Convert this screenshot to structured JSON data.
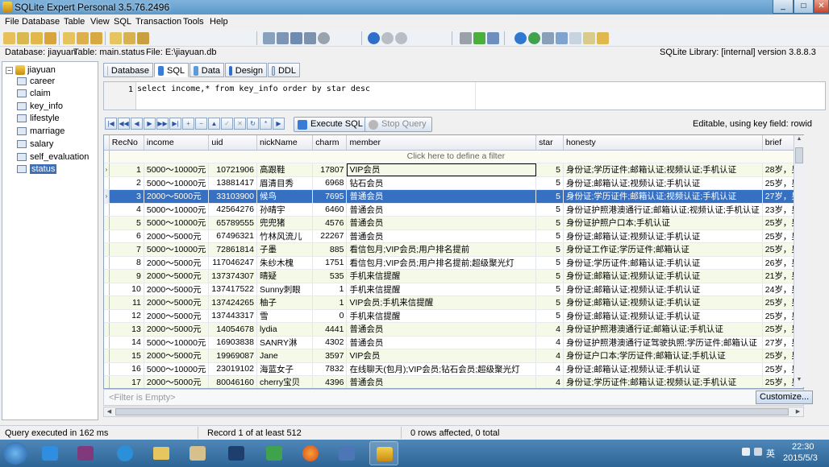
{
  "window": {
    "title": "SQLite Expert Personal 3.5.76.2496",
    "min": "_",
    "max": "□",
    "close": "✕"
  },
  "menu": [
    "File",
    "Database",
    "Table",
    "View",
    "SQL",
    "Transaction",
    "Tools",
    "Help"
  ],
  "info": {
    "database": "Database: jiayuan",
    "table": "Table: main.status",
    "file": "File: E:\\jiayuan.db",
    "library": "SQLite Library: [internal] version 3.8.8.3"
  },
  "tree": {
    "root": "jiayuan",
    "items": [
      "career",
      "claim",
      "key_info",
      "lifestyle",
      "marriage",
      "salary",
      "self_evaluation",
      "status"
    ],
    "selected": "status"
  },
  "tabs": [
    "Database",
    "SQL",
    "Data",
    "Design",
    "DDL"
  ],
  "active_tab": "SQL",
  "editor": {
    "line": "1",
    "query": "select income,* from key_info order by star desc"
  },
  "nav": {
    "buttons": [
      "|◀",
      "◀◀",
      "◀",
      "▶",
      "▶▶",
      "▶|",
      "+",
      "−",
      "▲",
      "✓",
      "✕",
      "↻",
      "*",
      "▶"
    ],
    "execute": "Execute SQL",
    "stop": "Stop Query",
    "status": "Editable, using key field: rowid"
  },
  "grid": {
    "columns": [
      "RecNo",
      "income",
      "uid",
      "nickName",
      "charm",
      "member",
      "star",
      "honesty",
      "brief"
    ],
    "filter_row": "Click here to define a filter",
    "filter_empty": "<Filter is Empty>",
    "customize": "Customize...",
    "selected_row": 2,
    "rows": [
      [
        "1",
        "5000～10000元",
        "10721906",
        "高跟鞋",
        "17807",
        "VIP会员",
        "5",
        "身份证;学历证件;邮箱认证;视频认证;手机认证",
        "28岁，另"
      ],
      [
        "2",
        "5000～10000元",
        "13881417",
        "眉清目秀",
        "6968",
        "钻石会员",
        "5",
        "身份证;邮箱认证;视频认证;手机认证",
        "25岁，男"
      ],
      [
        "3",
        "2000～5000元",
        "33103900",
        "候鸟",
        "7695",
        "普通会员",
        "5",
        "身份证;学历证件;邮箱认证;视频认证;手机认证",
        "27岁，男"
      ],
      [
        "4",
        "5000～10000元",
        "42564276",
        "孙晴宇",
        "6460",
        "普通会员",
        "5",
        "身份证护照港澳通行证;邮箱认证;视频认证;手机认证",
        "23岁，男"
      ],
      [
        "5",
        "5000～10000元",
        "65789555",
        "兜兜猪",
        "4576",
        "普通会员",
        "5",
        "身份证护照户口本;手机认证",
        "25岁，男"
      ],
      [
        "6",
        "2000～5000元",
        "67496321",
        "竹林风流儿",
        "22267",
        "普通会员",
        "5",
        "身份证;邮箱认证;视频认证;手机认证",
        "25岁，男"
      ],
      [
        "7",
        "5000～10000元",
        "72861814",
        "子墨",
        "885",
        "看信包月;VIP会员;用户排名提前",
        "5",
        "身份证工作证;学历证件;邮箱认证",
        "25岁，男"
      ],
      [
        "8",
        "2000～5000元",
        "117046247",
        "朱纱木槐",
        "1751",
        "看信包月;VIP会员;用户排名提前;超级聚光灯",
        "5",
        "身份证;学历证件;邮箱认证;手机认证",
        "26岁，男"
      ],
      [
        "9",
        "2000～5000元",
        "137374307",
        "晴疑",
        "535",
        "手机来信提醒",
        "5",
        "身份证;邮箱认证;视频认证;手机认证",
        "21岁，男"
      ],
      [
        "10",
        "2000～5000元",
        "137417522",
        "Sunny刺眼",
        "1",
        "手机来信提醒",
        "5",
        "身份证;邮箱认证;视频认证;手机认证",
        "24岁，男"
      ],
      [
        "11",
        "2000～5000元",
        "137424265",
        "柚子",
        "1",
        "VIP会员;手机来信提醒",
        "5",
        "身份证;邮箱认证;视频认证;手机认证",
        "25岁，男"
      ],
      [
        "12",
        "2000～5000元",
        "137443317",
        "雪",
        "0",
        "手机来信提醒",
        "5",
        "身份证;邮箱认证;视频认证;手机认证",
        "25岁，男"
      ],
      [
        "13",
        "2000～5000元",
        "14054678",
        "lydia",
        "4441",
        "普通会员",
        "4",
        "身份证护照港澳通行证;邮箱认证;手机认证",
        "25岁，男"
      ],
      [
        "14",
        "5000～10000元",
        "16903838",
        "SANRY淋",
        "4302",
        "普通会员",
        "4",
        "身份证护照港澳通行证驾驶执照;学历证件;邮箱认证",
        "27岁，男"
      ],
      [
        "15",
        "2000～5000元",
        "19969087",
        "Jane",
        "3597",
        "VIP会员",
        "4",
        "身份证户口本;学历证件;邮箱认证;手机认证",
        "25岁，男"
      ],
      [
        "16",
        "5000～10000元",
        "23019102",
        "海蓝女子",
        "7832",
        "在线聊天(包月);VIP会员;钻石会员;超级聚光灯",
        "4",
        "身份证;邮箱认证;视频认证;手机认证",
        "25岁，男"
      ],
      [
        "17",
        "2000～5000元",
        "80046160",
        "cherry宝贝",
        "4396",
        "普通会员",
        "4",
        "身份证;学历证件;邮箱认证;视频认证;手机认证",
        "25岁，男"
      ]
    ]
  },
  "status": {
    "left": "Query executed in 162 ms",
    "middle": "Record 1 of at least 512",
    "right": "0 rows affected, 0 total"
  },
  "tray": {
    "time": "22:30",
    "date": "2015/5/3",
    "ime": "英"
  }
}
